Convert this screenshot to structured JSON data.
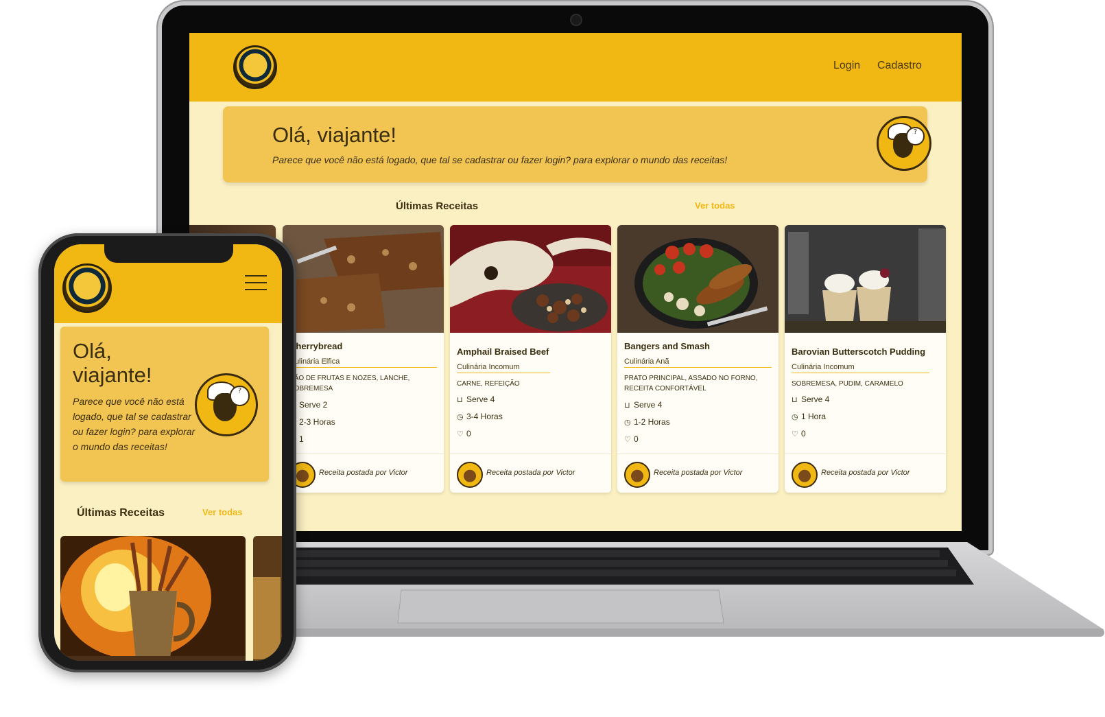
{
  "desktop": {
    "nav": {
      "login": "Login",
      "cadastro": "Cadastro"
    },
    "banner": {
      "greeting": "Olá, viajante!",
      "message": "Parece que você não está logado, que tal se cadastrar ou fazer login? para explorar o mundo das receitas!"
    },
    "section": {
      "title": "Últimas Receitas",
      "see_all": "Ver todas"
    },
    "cards": [
      {
        "title": "Cherrybread",
        "cuisine": "Culinária Elfica",
        "tags": "Pão de frutas e nozes, lanche, sobremesa",
        "serves": "Serve 2",
        "time": "2-3 Horas",
        "likes": "1",
        "poster": "Receita postada por Victor"
      },
      {
        "title": "Amphail Braised Beef",
        "cuisine": "Culinária Incomum",
        "tags": "Carne, Refeição",
        "serves": "Serve 4",
        "time": "3-4 Horas",
        "likes": "0",
        "poster": "Receita postada por Victor"
      },
      {
        "title": "Bangers and Smash",
        "cuisine": "Culinária Anã",
        "tags": "Prato principal, assado no forno, receita confortável",
        "serves": "Serve 4",
        "time": "1-2 Horas",
        "likes": "0",
        "poster": "Receita postada por Victor"
      },
      {
        "title": "Barovian Butterscotch Pudding",
        "cuisine": "Culinária Incomum",
        "tags": "Sobremesa, Pudim, Caramelo",
        "serves": "Serve 4",
        "time": "1 Hora",
        "likes": "0",
        "poster": "Receita postada por Victor"
      }
    ]
  },
  "mobile": {
    "banner": {
      "greeting": "Olá, viajante!",
      "message": "Parece que você não está logado, que tal se cadastrar ou fazer login? para explorar o mundo das receitas!"
    },
    "section": {
      "title": "Últimas Receitas",
      "see_all": "Ver todas"
    }
  },
  "colors": {
    "brand": "#f1b814",
    "banner": "#f2c553",
    "background": "#fbf0c2",
    "text": "#3a2e10"
  },
  "icons": {
    "serves": "pot-icon",
    "time": "timer-icon",
    "likes": "heart-icon",
    "menu": "hamburger-menu-icon"
  }
}
